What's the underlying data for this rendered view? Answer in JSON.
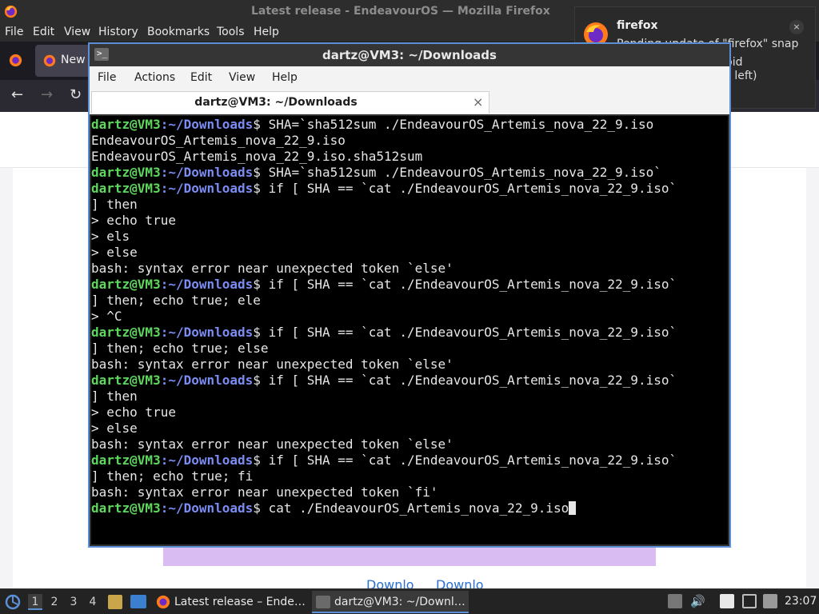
{
  "firefox": {
    "window_title": "Latest release - EndeavourOS — Mozilla Firefox",
    "menu": {
      "file": "File",
      "edit": "Edit",
      "view": "View",
      "history": "History",
      "bookmarks": "Bookmarks",
      "tools": "Tools",
      "help": "Help"
    },
    "tab_label": "New",
    "page_links": [
      "Downlo",
      "Downlo"
    ]
  },
  "notification": {
    "app": "firefox",
    "body_line1": "Pending update of \"firefox\" snap",
    "body_line2": "Close the app to avoid disruptions (13 days left)",
    "close_glyph": "×"
  },
  "terminal": {
    "window_title": "dartz@VM3: ~/Downloads",
    "menu": [
      "File",
      "Actions",
      "Edit",
      "View",
      "Help"
    ],
    "tab_title": "dartz@VM3: ~/Downloads",
    "tab_close": "×",
    "prompt_user": "dartz@VM3",
    "prompt_path": ":~/Downloads",
    "prompt_sym": "$ ",
    "lines": [
      {
        "type": "prompt",
        "text": "SHA=`sha512sum ./EndeavourOS_Artemis_nova_22_9.iso"
      },
      {
        "type": "out",
        "text": "EndeavourOS_Artemis_nova_22_9.iso"
      },
      {
        "type": "out",
        "text": "EndeavourOS_Artemis_nova_22_9.iso.sha512sum"
      },
      {
        "type": "prompt",
        "text": "SHA=`sha512sum ./EndeavourOS_Artemis_nova_22_9.iso`"
      },
      {
        "type": "prompt",
        "text": "if [ SHA == `cat ./EndeavourOS_Artemis_nova_22_9.iso`"
      },
      {
        "type": "out",
        "text": "] then"
      },
      {
        "type": "out",
        "text": "> echo true"
      },
      {
        "type": "out",
        "text": "> els"
      },
      {
        "type": "out",
        "text": "> else"
      },
      {
        "type": "out",
        "text": "bash: syntax error near unexpected token `else'"
      },
      {
        "type": "prompt",
        "text": "if [ SHA == `cat ./EndeavourOS_Artemis_nova_22_9.iso`"
      },
      {
        "type": "out",
        "text": "] then; echo true; ele"
      },
      {
        "type": "out",
        "text": "> ^C"
      },
      {
        "type": "prompt",
        "text": "if [ SHA == `cat ./EndeavourOS_Artemis_nova_22_9.iso`"
      },
      {
        "type": "out",
        "text": "] then; echo true; else"
      },
      {
        "type": "out",
        "text": "bash: syntax error near unexpected token `else'"
      },
      {
        "type": "prompt",
        "text": "if [ SHA == `cat ./EndeavourOS_Artemis_nova_22_9.iso`"
      },
      {
        "type": "out",
        "text": "] then"
      },
      {
        "type": "out",
        "text": "> echo true"
      },
      {
        "type": "out",
        "text": "> else"
      },
      {
        "type": "out",
        "text": "bash: syntax error near unexpected token `else'"
      },
      {
        "type": "prompt",
        "text": "if [ SHA == `cat ./EndeavourOS_Artemis_nova_22_9.iso`"
      },
      {
        "type": "out",
        "text": "] then; echo true; fi"
      },
      {
        "type": "out",
        "text": "bash: syntax error near unexpected token `fi'"
      },
      {
        "type": "prompt_cursor",
        "text": "cat ./EndeavourOS_Artemis_nova_22_9.iso"
      }
    ]
  },
  "taskbar": {
    "workspaces": [
      "1",
      "2",
      "3",
      "4"
    ],
    "active_workspace": "1",
    "tasks": [
      {
        "label": "Latest release – Ende…",
        "icon": "firefox-icon"
      },
      {
        "label": "dartz@VM3: ~/Downl…",
        "icon": "terminal-icon"
      }
    ],
    "clock": "23:07"
  },
  "colors": {
    "prompt_user": "#5dd75d",
    "prompt_path": "#7b8cf2",
    "accent": "#5b8fd6"
  }
}
